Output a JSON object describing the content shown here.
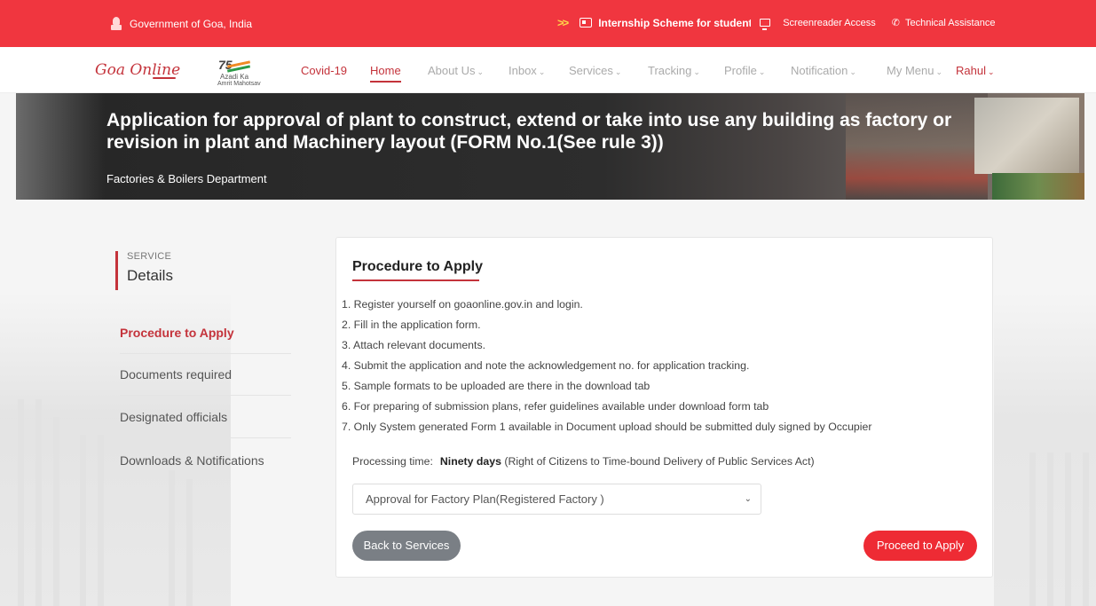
{
  "topbar": {
    "gov_label": "Government of Goa, India",
    "internship": "Internship Scheme for students",
    "screenreader": "Screenreader Access",
    "technical": "Technical Assistance"
  },
  "brand": {
    "logo": "Goa Online",
    "azadi_number": "75",
    "azadi_line1": "Azadi Ka",
    "azadi_line2": "Amrit Mahotsav"
  },
  "nav": {
    "covid": "Covid-19",
    "home": "Home",
    "about": "About Us",
    "inbox": "Inbox",
    "services": "Services",
    "tracking": "Tracking",
    "profile": "Profile",
    "notification": "Notification",
    "mymenu": "My Menu",
    "user": "Rahul"
  },
  "banner": {
    "title": "Application for approval of plant to construct, extend or take into use any building as factory or revision in plant and Machinery layout (FORM No.1(See rule 3))",
    "department": "Factories & Boilers Department"
  },
  "sidebar": {
    "label_small": "SERVICE",
    "label_big": "Details",
    "items": [
      {
        "label": "Procedure to Apply"
      },
      {
        "label": "Documents required"
      },
      {
        "label": "Designated officials"
      },
      {
        "label": "Downloads & Notifications"
      }
    ]
  },
  "card": {
    "title": "Procedure to Apply",
    "steps": [
      "1. Register yourself on goaonline.gov.in and login.",
      "2. Fill in the application form.",
      "3. Attach relevant documents.",
      "4. Submit the application and note the acknowledgement no. for application tracking.",
      "5. Sample formats to be uploaded are there in the download tab",
      "6. For preparing of submission plans, refer guidelines available under download form tab",
      "7. Only System generated Form 1 available in Document upload should be submitted duly signed by Occupier"
    ],
    "processing_label": "Processing time:",
    "processing_value": "Ninety days",
    "processing_note": "(Right of Citizens to Time-bound Delivery of Public Services Act)",
    "select_value": "Approval for Factory Plan(Registered Factory )",
    "back_button": "Back to Services",
    "proceed_button": "Proceed to Apply"
  },
  "colors": {
    "topbar": "#f0363f",
    "accent": "#c4333b",
    "proceed": "#ee2b34",
    "back": "#7a7f85"
  }
}
